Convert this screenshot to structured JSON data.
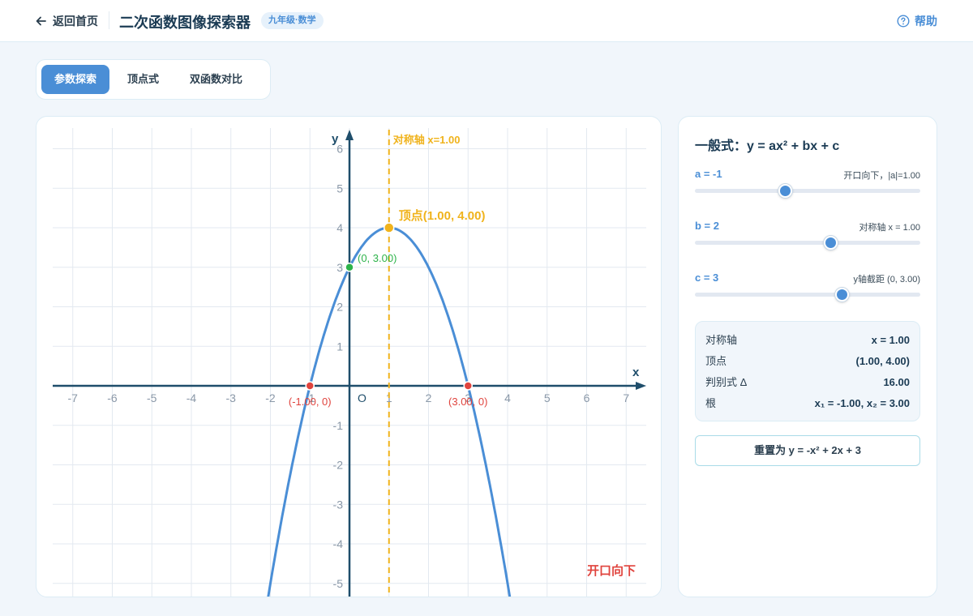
{
  "header": {
    "back_label": "返回首页",
    "title": "二次函数图像探索器",
    "grade_badge": "九年级·数学",
    "help_label": "帮助"
  },
  "tabs": [
    {
      "label": "参数探索",
      "active": true
    },
    {
      "label": "顶点式",
      "active": false
    },
    {
      "label": "双函数对比",
      "active": false
    }
  ],
  "graph": {
    "x_axis_label": "x",
    "y_axis_label": "y",
    "origin_label": "O",
    "axis_of_symmetry_label": "对称轴 x=1.00",
    "vertex_label": "顶点(1.00, 4.00)",
    "y_intercept_label": "(0, 3.00)",
    "root_labels": [
      "(-1.00, 0)",
      "(3.00, 0)"
    ],
    "opening_label": "开口向下",
    "x_ticks": [
      -7,
      -6,
      -5,
      -4,
      -3,
      -2,
      -1,
      1,
      2,
      3,
      4,
      5,
      6,
      7
    ],
    "y_ticks": [
      6,
      5,
      4,
      3,
      2,
      1,
      -1,
      -2,
      -3,
      -4,
      -5
    ],
    "coefficients": {
      "a": -1,
      "b": 2,
      "c": 3
    },
    "vertex": [
      1,
      4
    ],
    "y_intercept": [
      0,
      3
    ],
    "roots": [
      -1,
      3
    ],
    "axis_x": 1,
    "x_range": [
      -7.5,
      7.5
    ],
    "y_range": [
      -5,
      6.5
    ],
    "colors": {
      "curve": "#4a8ed6",
      "axis": "#1f4e6b",
      "symmetry": "#f0b31c",
      "root": "#e0443e",
      "intercept": "#2db34a",
      "grid": "#e3e9f0"
    }
  },
  "panel": {
    "formula_title": "一般式：y = ax² + bx + c",
    "params": [
      {
        "label": "a = -1",
        "note": "开口向下，|a|=1.00",
        "value": -1,
        "min": -5,
        "max": 5
      },
      {
        "label": "b = 2",
        "note": "对称轴 x = 1.00",
        "value": 2,
        "min": -10,
        "max": 10
      },
      {
        "label": "c = 3",
        "note": "y轴截距 (0, 3.00)",
        "value": 3,
        "min": -10,
        "max": 10
      }
    ],
    "info": [
      {
        "key": "对称轴",
        "value": "x = 1.00"
      },
      {
        "key": "顶点",
        "value": "(1.00, 4.00)"
      },
      {
        "key": "判别式 Δ",
        "value": "16.00"
      },
      {
        "key": "根",
        "value": "x₁ = -1.00, x₂ = 3.00"
      }
    ],
    "reset_label": "重置为 y = -x² + 2x + 3"
  }
}
